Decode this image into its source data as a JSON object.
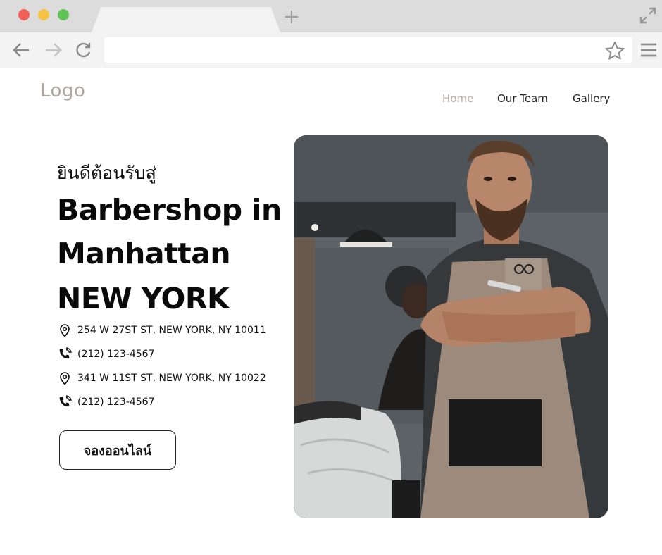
{
  "browser": {
    "window_controls": [
      "close",
      "minimize",
      "maximize"
    ],
    "icons": {
      "back": "arrow-left-icon",
      "forward": "arrow-right-icon",
      "reload": "reload-icon",
      "bookmark": "star-icon",
      "menu": "hamburger-menu-icon",
      "new_tab": "plus-icon",
      "fullscreen": "expand-icon"
    },
    "url": ""
  },
  "header": {
    "logo": "Logo",
    "nav": [
      {
        "label": "Home",
        "active": true
      },
      {
        "label": "Our Team",
        "active": false
      },
      {
        "label": "Gallery",
        "active": false
      }
    ]
  },
  "hero": {
    "welcome": "ยินดีต้อนรับสู่",
    "headline_lines": [
      "Barbershop in",
      "Manhattan",
      "NEW YORK"
    ],
    "contacts": [
      {
        "icon": "location-pin-icon",
        "text": "254 W 27ST ST, NEW YORK, NY 10011"
      },
      {
        "icon": "phone-icon",
        "text": "(212) 123-4567"
      },
      {
        "icon": "location-pin-icon",
        "text": "341 W 11ST ST, NEW YORK, NY 10022"
      },
      {
        "icon": "phone-icon",
        "text": "(212) 123-4567"
      }
    ],
    "cta_label": "จองออนไลน์",
    "image": "barber-photo"
  },
  "colors": {
    "nav_active": "#b3a89f",
    "logo": "#b0a79f",
    "text": "#111111"
  }
}
